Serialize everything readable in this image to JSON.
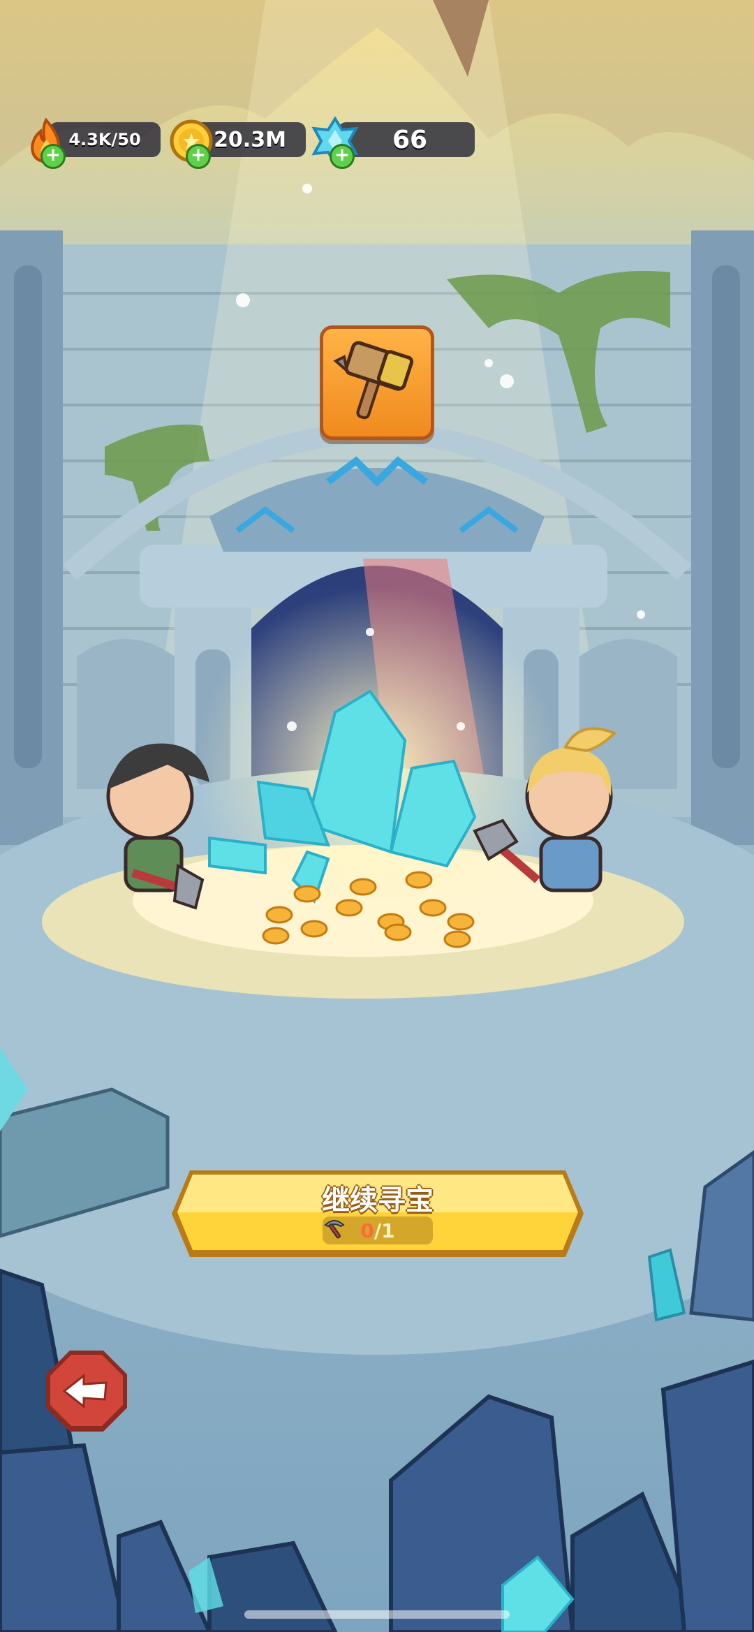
{
  "resources": {
    "energy": {
      "value": "4.3K/50",
      "icon": "flame-icon"
    },
    "gold": {
      "value": "20.3M",
      "icon": "coin-icon"
    },
    "gems": {
      "value": "66",
      "icon": "crystal-icon"
    }
  },
  "reward": {
    "icon": "hammer-icon"
  },
  "continue_button": {
    "label": "继续寻宝",
    "current": "0",
    "separator": "/",
    "max": "1",
    "icon": "pickaxe-icon"
  },
  "back_button": {
    "icon": "back-arrow-icon"
  },
  "colors": {
    "button_yellow": "#ffd43b",
    "badge_orange": "#f5921e",
    "back_red": "#c8392b"
  }
}
